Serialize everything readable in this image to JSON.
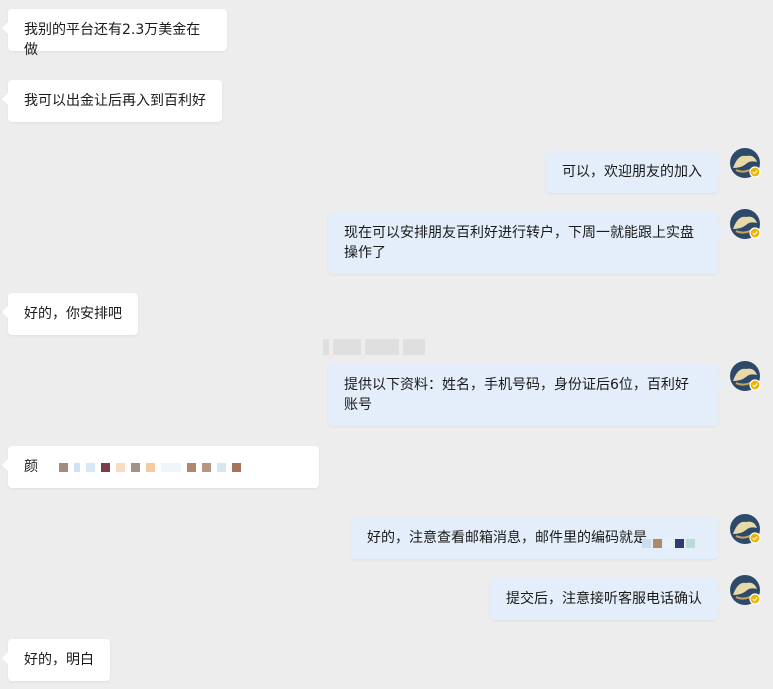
{
  "colors": {
    "background": "#ededed",
    "incoming_bubble": "#ffffff",
    "outgoing_bubble": "#e3eefa",
    "text": "#1a1a1a",
    "badge": "#f0b400"
  },
  "messages": [
    {
      "side": "left",
      "text": "我别的平台还有2.3万美金在做"
    },
    {
      "side": "left",
      "text": "我可以出金让后再入到百利好"
    },
    {
      "side": "right",
      "text": "可以，欢迎朋友的加入"
    },
    {
      "side": "right",
      "text": "现在可以安排朋友百利好进行转户，下周一就能跟上实盘操作了"
    },
    {
      "side": "left",
      "text": "好的，你安排吧"
    },
    {
      "side": "right",
      "text": "提供以下资料：姓名，手机号码，身份证后6位，百利好账号"
    },
    {
      "side": "left",
      "text": "颜",
      "redacted": true
    },
    {
      "side": "right",
      "text": "好的，注意查看邮箱消息，邮件里的编码就是",
      "redacted": true
    },
    {
      "side": "right",
      "text": "提交后，注意接听客服电话确认"
    },
    {
      "side": "left",
      "text": "好的，明白"
    }
  ],
  "avatar_icon": "user-avatar-icon",
  "badge_icon": "verified-badge-icon"
}
